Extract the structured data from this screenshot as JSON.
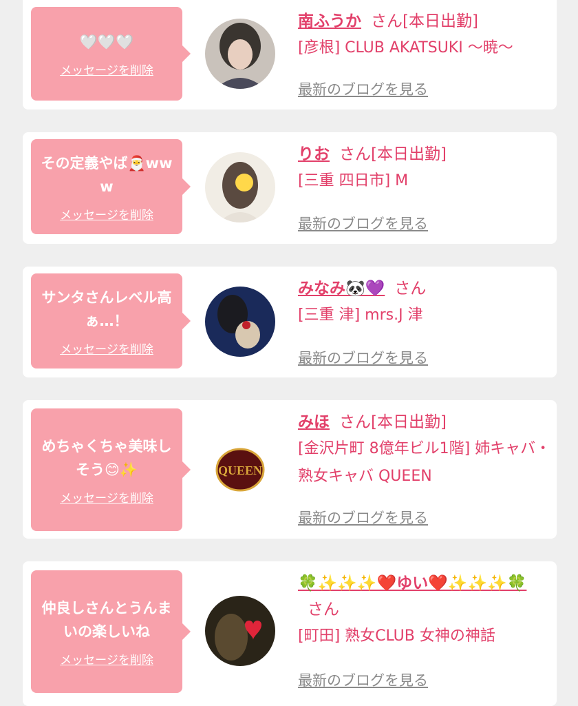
{
  "messages": [
    {
      "message": "🤍🤍🤍",
      "delete_label": "メッセージを削除",
      "name": "南ふうか",
      "status": "さん[本日出勤]",
      "shop": "[彦根] CLUB AKATSUKI ～暁～",
      "blog_label": "最新のブログを見る",
      "avatar_colors": [
        "#3a3530",
        "#e8cfc0"
      ]
    },
    {
      "message": "その定義やば🎅www",
      "delete_label": "メッセージを削除",
      "name": "りお",
      "status": "さん[本日出勤]",
      "shop": "[三重 四日市] M",
      "blog_label": "最新のブログを見る",
      "avatar_colors": [
        "#5a4a40",
        "#f1ede5"
      ]
    },
    {
      "message": "サンタさんレベル高ぁ…！",
      "delete_label": "メッセージを削除",
      "name": "みなみ🐼💜",
      "status": "さん",
      "shop": "[三重 津] mrs.J 津",
      "blog_label": "最新のブログを見る",
      "avatar_colors": [
        "#1a2a5a",
        "#d8c8b0"
      ]
    },
    {
      "message": "めちゃくちゃ美味しそう😊✨",
      "delete_label": "メッセージを削除",
      "name": "みほ",
      "status": "さん[本日出勤]",
      "shop": "[金沢片町 8億年ビル1階] 姉キャバ・熟女キャバ QUEEN",
      "blog_label": "最新のブログを見る",
      "avatar_text": "QUEEN",
      "avatar_colors": [
        "#5a1010",
        "#d9a63a"
      ]
    },
    {
      "message": "仲良しさんとうんまいの楽しいね",
      "delete_label": "メッセージを削除",
      "name": "🍀✨✨✨❤️ゆい❤️✨✨✨🍀",
      "status": "さん",
      "shop": "[町田] 熟女CLUB 女神の神話",
      "blog_label": "最新のブログを見る",
      "avatar_colors": [
        "#2a2418",
        "#e0253a"
      ]
    }
  ]
}
